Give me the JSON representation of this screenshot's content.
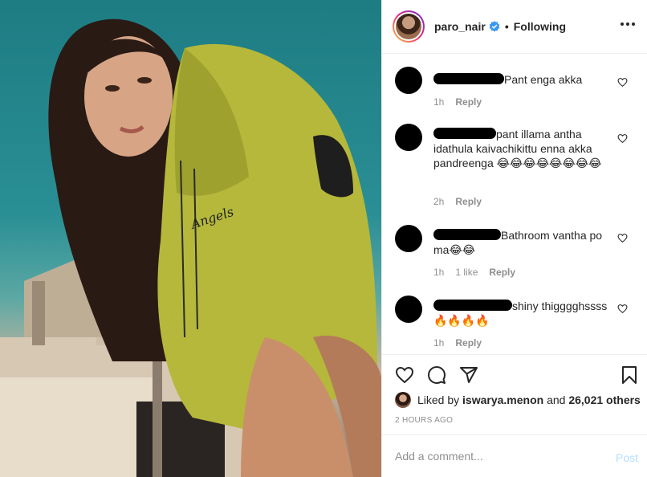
{
  "post": {
    "username": "paro_nair",
    "follow_status": "Following",
    "separator": "•"
  },
  "photo": {
    "hoodie_text": "Angels"
  },
  "comments": [
    {
      "text": "Pant enga akka",
      "time": "1h",
      "likes": "",
      "reply_label": "Reply"
    },
    {
      "text": "pant illama antha idathula kaivachikittu enna akka pandreenga 😂😂😂😂😂😂😂😂",
      "time": "2h",
      "likes": "",
      "reply_label": "Reply"
    },
    {
      "text": "Bathroom vantha po ma😂😂",
      "time": "1h",
      "likes": "1 like",
      "reply_label": "Reply"
    },
    {
      "text": "shiny thigggghssss 🔥🔥🔥🔥",
      "time": "1h",
      "likes": "",
      "reply_label": "Reply"
    }
  ],
  "likes": {
    "prefix": "Liked by",
    "user": "iswarya.menon",
    "joiner": "and",
    "count": "26,021 others"
  },
  "timestamp": "2 HOURS AGO",
  "add_comment": {
    "placeholder": "Add a comment...",
    "post_label": "Post"
  },
  "icons": {
    "like": "heart-icon",
    "comment": "comment-icon",
    "share": "share-icon",
    "save": "bookmark-icon",
    "verified": "verified-badge-icon",
    "more": "more-options-icon"
  },
  "colors": {
    "verified": "#3897f0",
    "post_disabled": "#b2dffc",
    "hoodie": "#b5b83a"
  }
}
